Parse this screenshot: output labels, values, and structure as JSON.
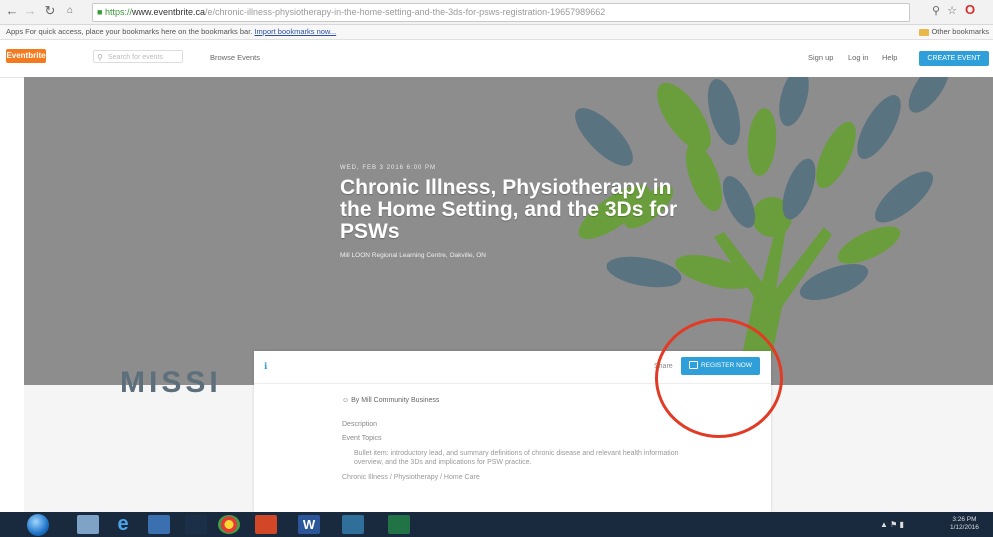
{
  "browser": {
    "url_https": "https://",
    "url_host": "www.eventbrite.ca",
    "url_path": "/e/chronic-illness-physiotherapy-in-the-home-setting-and-the-3ds-for-psws-registration-19657989662",
    "bookmarks_bar_text": "Apps   For quick access, place your bookmarks here on the bookmarks bar.",
    "bookmarks_import_link": "Import bookmarks now...",
    "other_bookmarks": "Other bookmarks"
  },
  "nav": {
    "logo_text": "Eventbrite",
    "search_placeholder": "Search for events",
    "browse_events": "Browse Events",
    "links": [
      "Sign up",
      "Log in",
      "Help"
    ],
    "create_event": "CREATE EVENT"
  },
  "hero": {
    "date": "WED, FEB 3 2016 6:00 PM",
    "title": "Chronic Illness, Physiotherapy in the Home Setting, and the 3Ds for PSWs",
    "venue": "Mill LOON Regional Learning Centre, Oakville, ON",
    "background_text": "MISSI"
  },
  "card": {
    "share_label": "Share",
    "register_button": "REGISTER NOW",
    "organizer": "By Mill Community Business",
    "heading_1": "Description",
    "heading_2": "Event Topics",
    "paragraph": "Bullet item: introductory lead, and summary definitions of chronic disease and relevant health information overview, and the 3Ds and implications for PSW practice.",
    "paragraph_2": "Chronic Illness / Physiotherapy / Home Care"
  },
  "taskbar": {
    "clock_time": "3:26 PM",
    "clock_date": "1/12/2016"
  },
  "colors": {
    "accent_blue": "#2e9fd8",
    "eventbrite_orange": "#f47a20",
    "highlight_red": "#e23b25",
    "hero_gray": "#8d8d8d",
    "leaf_green": "#6a9e3c",
    "leaf_blue_gray": "#5a7380"
  }
}
